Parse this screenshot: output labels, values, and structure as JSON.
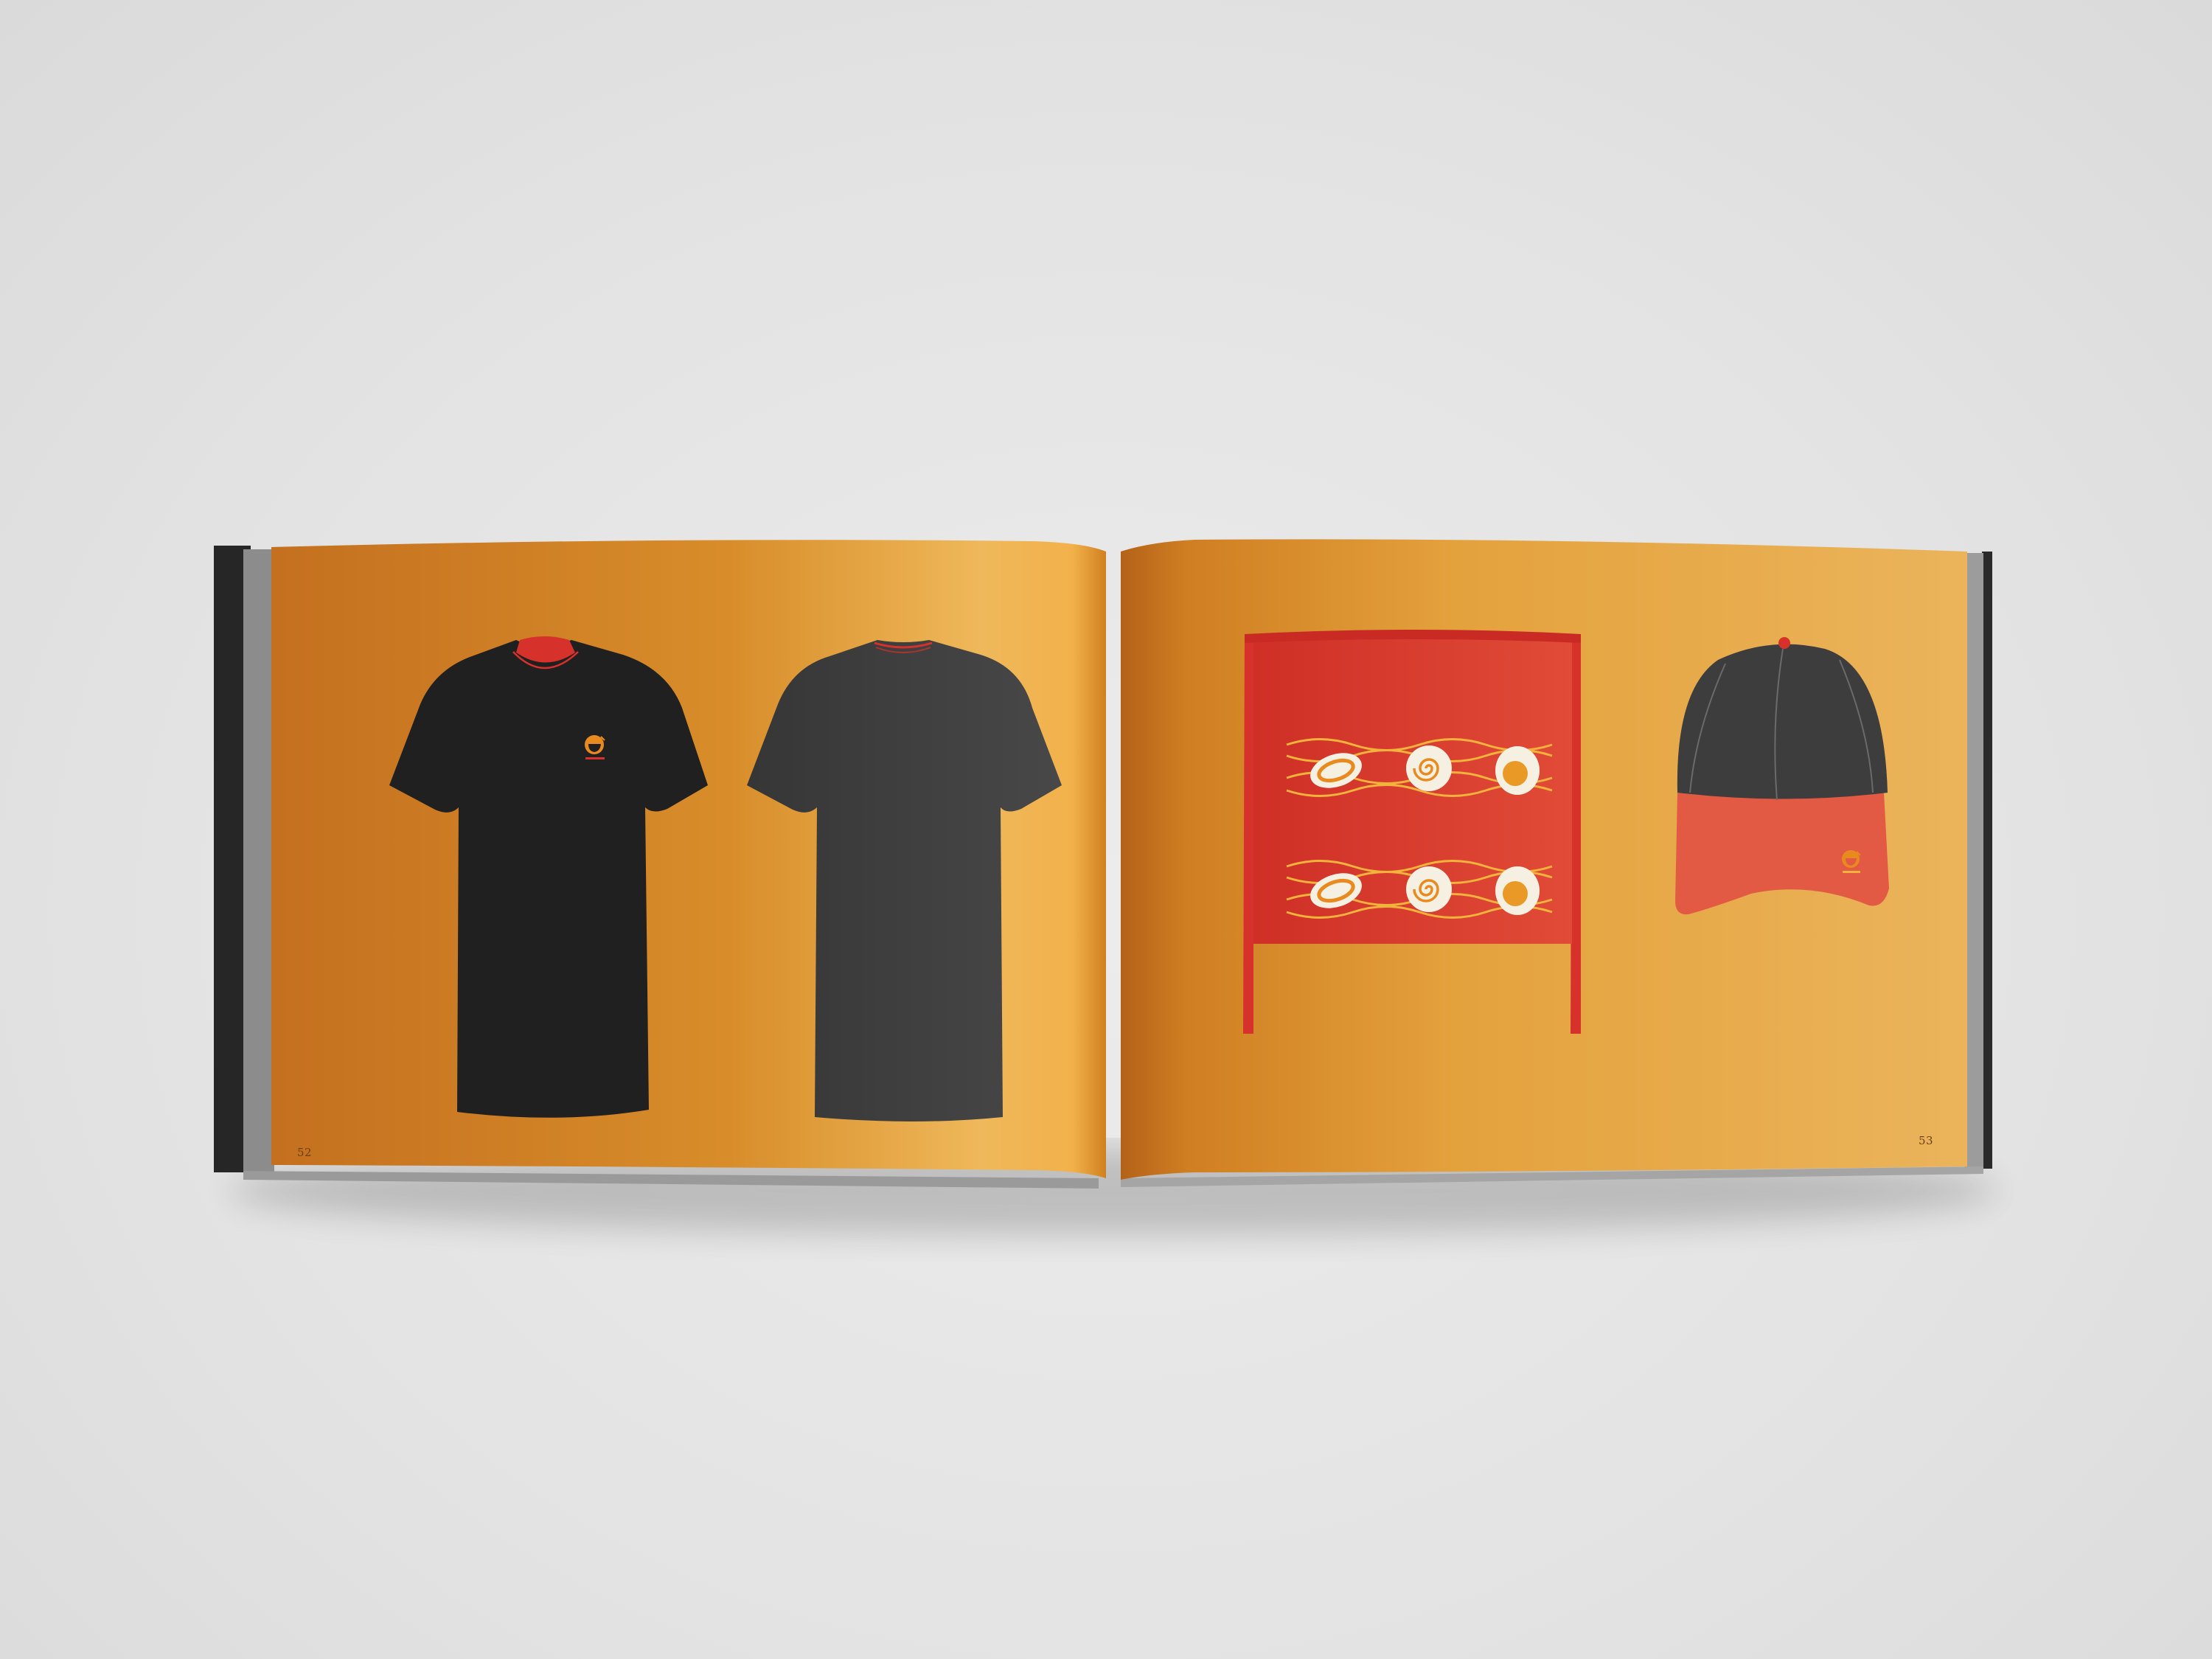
{
  "scene": {
    "description_colors": {
      "background": "#e4e4e4",
      "page_orange_dark": "#c8701d",
      "page_orange_light": "#f0bd62",
      "shirt_front": "#212020",
      "shirt_back": "#3b3b3b",
      "accent_red": "#d6322b",
      "cap_crown": "#3d3d3d",
      "cap_visor": "#e35a44",
      "logo_orange": "#e98a1f"
    }
  },
  "book": {
    "left_page": {
      "page_number": "52",
      "items": [
        "tshirt-front",
        "tshirt-back"
      ]
    },
    "right_page": {
      "page_number": "53",
      "items": [
        "apron",
        "baseball-cap"
      ]
    }
  },
  "logo": {
    "icon": "ramen-bowl-logo-icon"
  }
}
